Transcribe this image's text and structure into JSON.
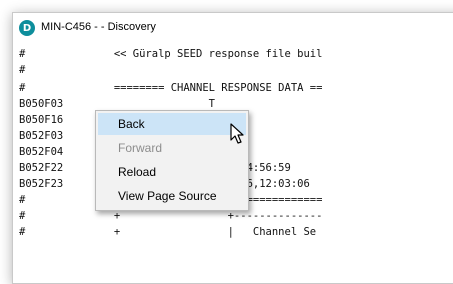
{
  "window": {
    "app_icon_letter": "D",
    "title": "MIN-C456 -  - Discovery"
  },
  "content": {
    "lines": [
      "#              << Güralp SEED response file buil",
      "#",
      "#              ======== CHANNEL RESPONSE DATA ==",
      "B050F03                       T",
      "B050F16",
      "B052F03",
      "B052F04",
      "B052F22                      8,045,14:56:59",
      "B052F23       End date:      2018,046,12:03:06",
      "#              =================================",
      "#              +                 +--------------",
      "#              +                 |   Channel Se"
    ]
  },
  "context_menu": {
    "items": [
      {
        "label": "Back",
        "state": "hover"
      },
      {
        "label": "Forward",
        "state": "disabled"
      },
      {
        "label": "Reload",
        "state": "normal"
      },
      {
        "label": "View Page Source",
        "state": "normal"
      }
    ]
  },
  "colors": {
    "app_icon": "#0e8e9c",
    "menu_background": "#f2f2f2",
    "menu_hover": "#cce4f7",
    "menu_disabled_text": "#8d8d8d"
  },
  "icons": {
    "app": "discovery-app-icon",
    "cursor": "mouse-pointer-icon"
  }
}
